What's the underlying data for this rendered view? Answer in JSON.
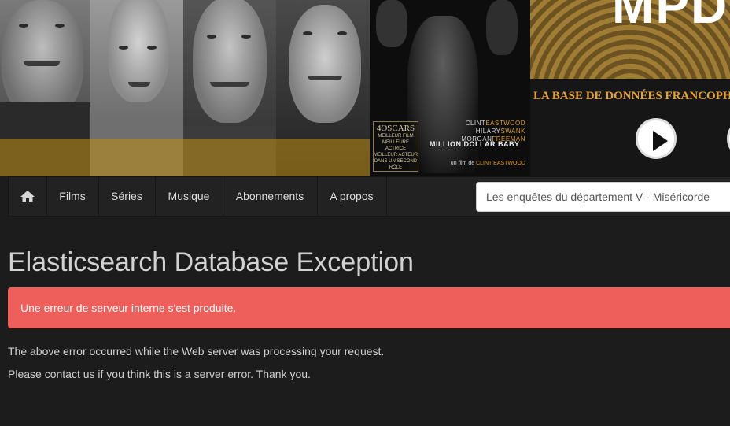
{
  "banner": {
    "poster": {
      "oscars_count": "4",
      "oscars_label": "OSCARS",
      "award_lines": [
        "MEILLEUR FILM",
        "MEILLEURE ACTRICE",
        "MEILLEUR ACTEUR",
        "DANS UN SECOND RÔLE"
      ],
      "credits": [
        {
          "first": "CLINT",
          "last": "EASTWOOD"
        },
        {
          "first": "HILARY",
          "last": "SWANK"
        },
        {
          "first": "MORGAN",
          "last": "FREEMAN"
        }
      ],
      "movie_title": "MILLION DOLLAR BABY",
      "director_prefix": "un film de",
      "director": "CLINT EASTWOOD"
    },
    "logo_text": "MPD",
    "tagline": "LA BASE DE DONNÉES FRANCOPH"
  },
  "nav": {
    "home_icon": "home-icon",
    "items": [
      "Films",
      "Séries",
      "Musique",
      "Abonnements",
      "A propos"
    ]
  },
  "search": {
    "value": "Les enquêtes du département V - Miséricorde"
  },
  "main": {
    "title": "Elasticsearch Database Exception",
    "alert": "Une erreur de serveur interne s'est produite.",
    "paragraphs": [
      "The above error occurred while the Web server was processing your request.",
      "Please contact us if you think this is a server error. Thank you."
    ]
  },
  "colors": {
    "background": "#1c1c1c",
    "navbar": "#222222",
    "alert": "#ee5f5b",
    "gold": "#e9a32a"
  }
}
